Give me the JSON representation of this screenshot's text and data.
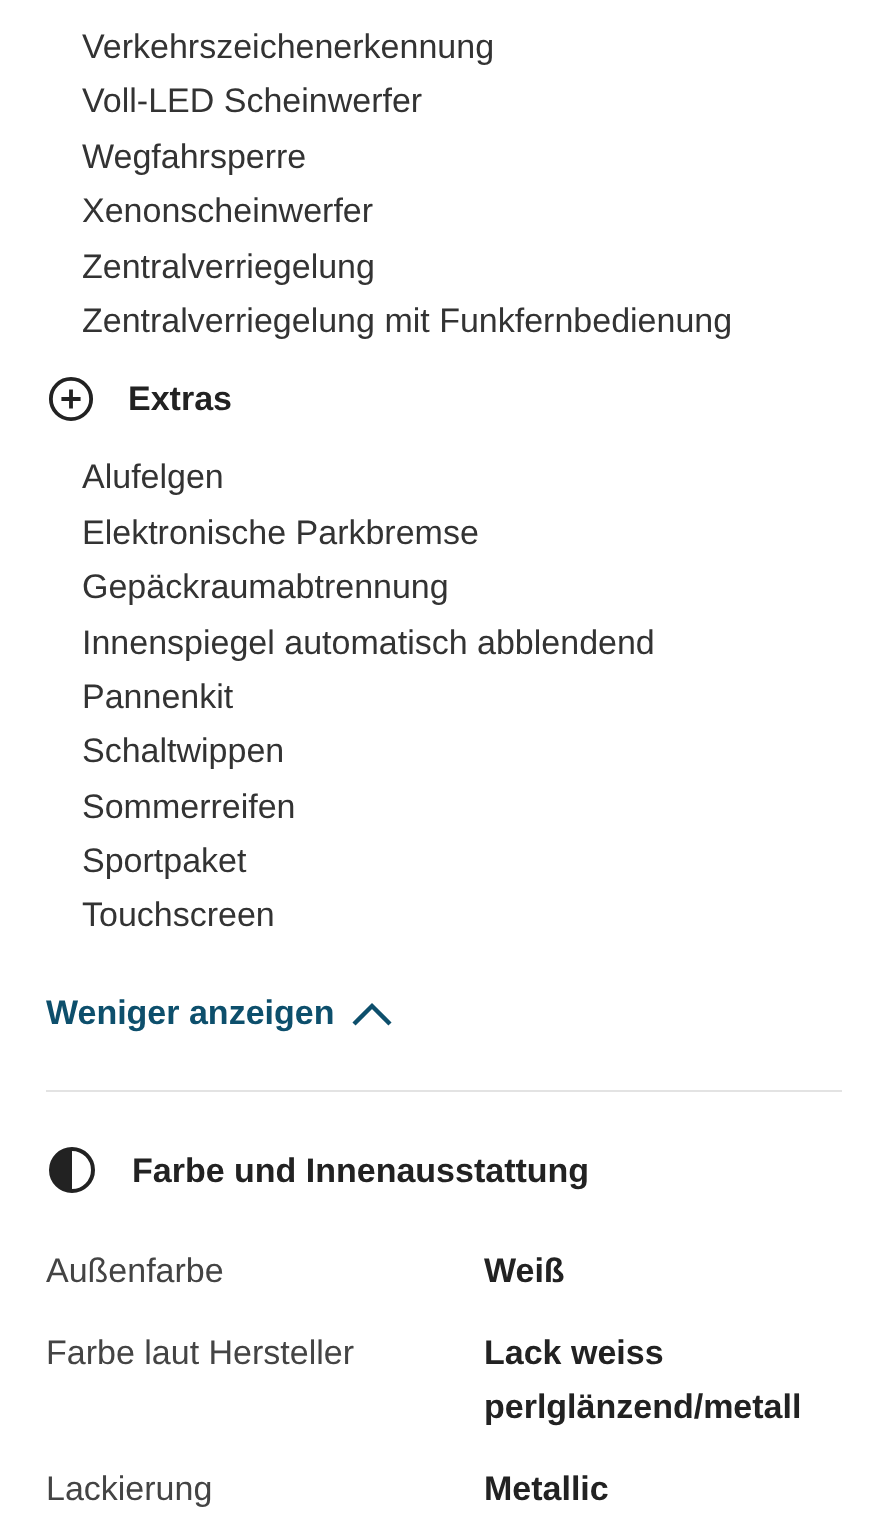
{
  "equipment": {
    "items": [
      "Verkehrszeichenerkennung",
      "Voll-LED Scheinwerfer",
      "Wegfahrsperre",
      "Xenonscheinwerfer",
      "Zentralverriegelung",
      "Zentralverriegelung mit Funkfernbedienung"
    ],
    "groups": [
      {
        "title": "Extras",
        "items": [
          "Alufelgen",
          "Elektronische Parkbremse",
          "Gepäckraumabtrennung",
          "Innenspiegel automatisch abblendend",
          "Pannenkit",
          "Schaltwippen",
          "Sommerreifen",
          "Sportpaket",
          "Touchscreen"
        ]
      }
    ],
    "toggle": {
      "label": "Weniger anzeigen",
      "expanded": true
    }
  },
  "color_section": {
    "title": "Farbe und Innenausstattung",
    "rows": [
      {
        "label": "Außenfarbe",
        "value": "Weiß"
      },
      {
        "label": "Farbe laut Hersteller",
        "value": "Lack weiss perlglänzend/metall"
      },
      {
        "label": "Lackierung",
        "value": "Metallic"
      }
    ]
  }
}
